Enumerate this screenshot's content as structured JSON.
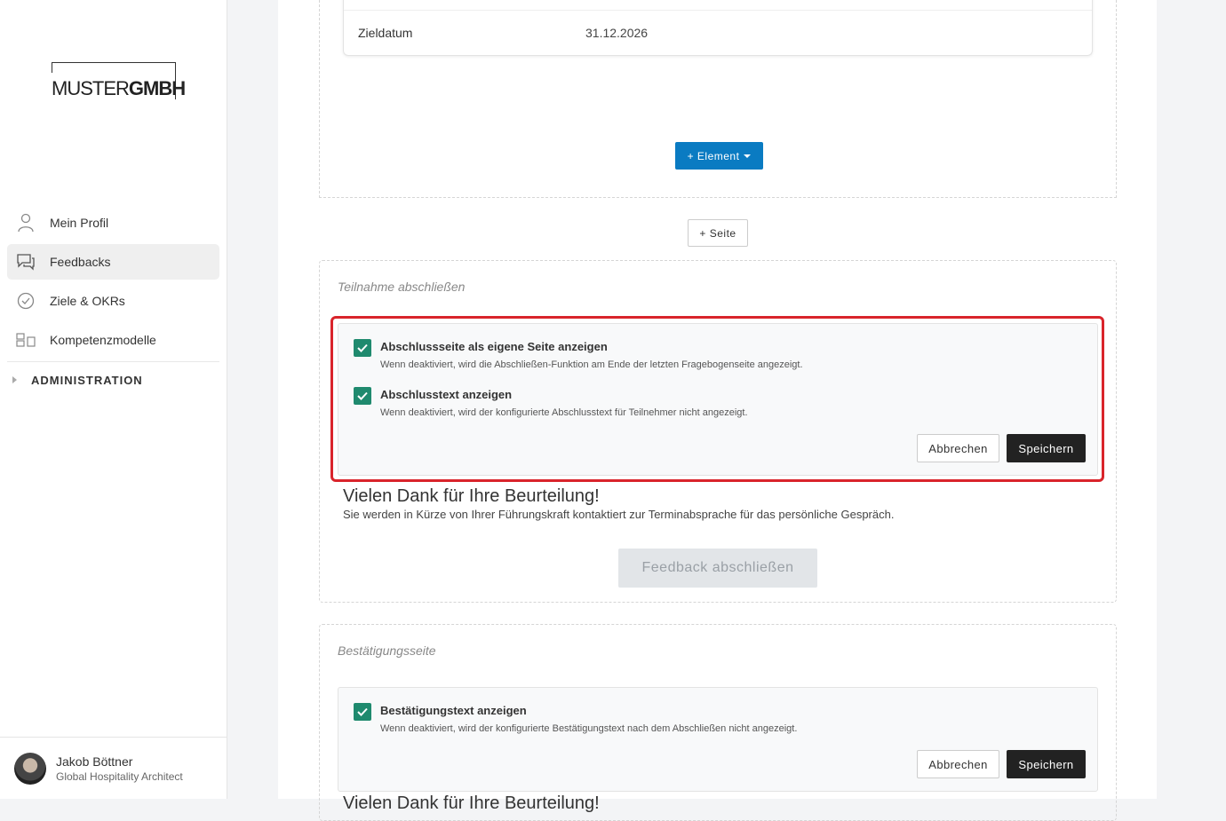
{
  "brand": {
    "logo_light": "MUSTER",
    "logo_bold": "GMBH"
  },
  "sidebar": {
    "items": [
      {
        "label": "Mein Profil",
        "icon": "user-icon"
      },
      {
        "label": "Feedbacks",
        "icon": "chat-icon"
      },
      {
        "label": "Ziele & OKRs",
        "icon": "check-circle-icon"
      },
      {
        "label": "Kompetenzmodelle",
        "icon": "grid-icon"
      }
    ],
    "admin_label": "ADMINISTRATION"
  },
  "user": {
    "name": "Jakob Böttner",
    "role": "Global Hospitality Architect"
  },
  "top_table": {
    "key": "Zieldatum",
    "value": "31.12.2026"
  },
  "buttons": {
    "element": "+ Element",
    "seite": "+ Seite"
  },
  "section_finish": {
    "title": "Teilnahme abschließen",
    "options": [
      {
        "label": "Abschlussseite als eigene Seite anzeigen",
        "desc": "Wenn deaktiviert, wird die Abschließen-Funktion am Ende der letzten Fragebogenseite angezeigt.",
        "checked": true
      },
      {
        "label": "Abschlusstext anzeigen",
        "desc": "Wenn deaktiviert, wird der konfigurierte Abschlusstext für Teilnehmer nicht angezeigt.",
        "checked": true
      }
    ],
    "cancel": "Abbrechen",
    "save": "Speichern",
    "thanks_title": "Vielen Dank für Ihre Beurteilung!",
    "thanks_text": "Sie werden in Kürze von Ihrer Führungskraft kontaktiert zur Terminabsprache für das persönliche Gespräch.",
    "finish_button": "Feedback abschließen"
  },
  "section_confirm": {
    "title": "Bestätigungsseite",
    "options": [
      {
        "label": "Bestätigungstext anzeigen",
        "desc": "Wenn deaktiviert, wird der konfigurierte Bestätigungstext nach dem Abschließen nicht angezeigt.",
        "checked": true
      }
    ],
    "cancel": "Abbrechen",
    "save": "Speichern",
    "cut_text": "Vielen Dank für Ihre Beurteilung!"
  },
  "colors": {
    "primary": "#0a7bc2",
    "check": "#1f8a6e",
    "highlight": "#d9242b"
  }
}
